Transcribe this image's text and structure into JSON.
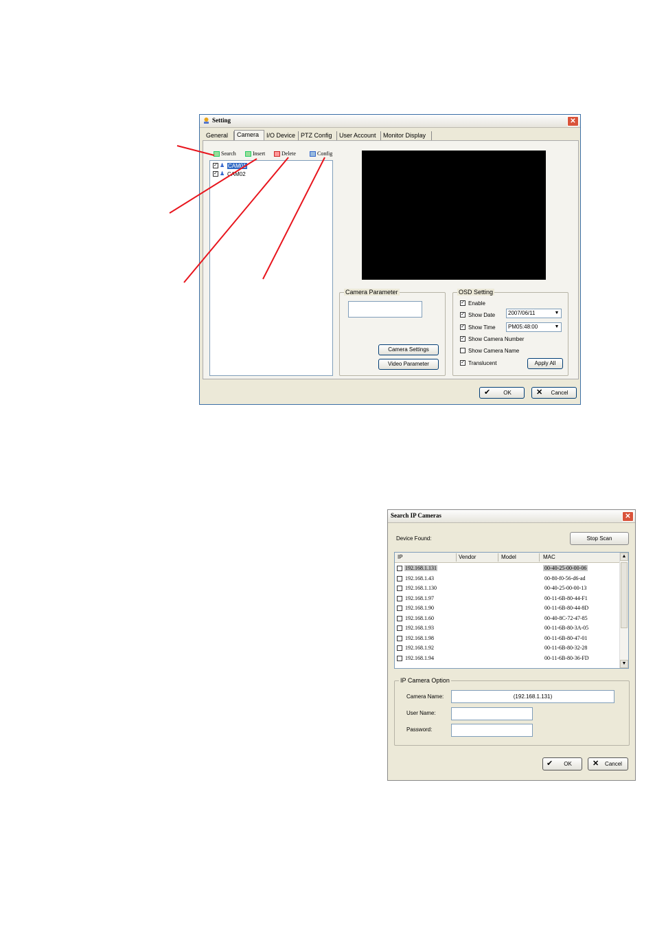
{
  "setting_window": {
    "title": "Setting",
    "tabs": [
      "General",
      "Camera",
      "I/O Device",
      "PTZ Config",
      "User Account",
      "Monitor Display"
    ],
    "active_tab": "Camera",
    "toolbar": {
      "search": "Search",
      "insert": "Insert",
      "delete": "Delete",
      "config": "Config"
    },
    "cameras": [
      "CAM01",
      "CAM02"
    ],
    "camera_parameter": {
      "label": "Camera Parameter",
      "camera_settings": "Camera Settings",
      "video_parameter": "Video Parameter"
    },
    "osd": {
      "label": "OSD Setting",
      "enable": "Enable",
      "show_date": "Show Date",
      "date_value": "2007/06/11",
      "show_time": "Show Time",
      "time_value": "PM05:48:00",
      "show_camera_number": "Show Camera Number",
      "show_camera_name": "Show Camera Name",
      "translucent": "Translucent",
      "apply_all": "Apply All"
    },
    "ok": "OK",
    "cancel": "Cancel"
  },
  "search_window": {
    "title": "Search IP Cameras",
    "device_found": "Device Found:",
    "stop_scan": "Stop Scan",
    "columns": {
      "ip": "IP",
      "vendor": "Vendor",
      "model": "Model",
      "mac": "MAC"
    },
    "rows": [
      {
        "ip": "192.168.1.131",
        "mac": "00-40-25-00-00-06"
      },
      {
        "ip": "192.168.1.43",
        "mac": "00-80-f0-56-d6-ad"
      },
      {
        "ip": "192.168.1.130",
        "mac": "00-40-25-00-00-13"
      },
      {
        "ip": "192.168.1.97",
        "mac": "00-11-6B-80-44-F1"
      },
      {
        "ip": "192.168.1.90",
        "mac": "00-11-6B-80-44-8D"
      },
      {
        "ip": "192.168.1.60",
        "mac": "00-40-8C-72-47-85"
      },
      {
        "ip": "192.168.1.93",
        "mac": "00-11-6B-80-3A-05"
      },
      {
        "ip": "192.168.1.98",
        "mac": "00-11-6B-80-47-01"
      },
      {
        "ip": "192.168.1.92",
        "mac": "00-11-6B-80-32-28"
      },
      {
        "ip": "192.168.1.94",
        "mac": "00-11-6B-80-36-FD"
      }
    ],
    "option": {
      "label": "IP Camera Option",
      "camera_name_label": "Camera Name:",
      "camera_name_value": "(192.168.1.131)",
      "user_name_label": "User Name:",
      "password_label": "Password:"
    },
    "ok": "OK",
    "cancel": "Cancel"
  },
  "colors": {
    "annotation_arrow": "#e8141c",
    "selection": "#316ac5",
    "window_bg": "#ece9d8"
  }
}
